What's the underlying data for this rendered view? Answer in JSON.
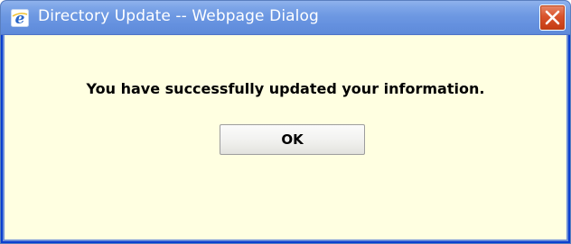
{
  "window": {
    "title": "Directory Update -- Webpage Dialog",
    "icon": "internet-explorer-icon",
    "close_icon": "close-icon"
  },
  "dialog": {
    "message": "You have successfully updated your information.",
    "ok_label": "OK"
  },
  "colors": {
    "titlebar": "#7aa2e6",
    "content_background": "#ffffe1",
    "close_button": "#d9532c"
  }
}
